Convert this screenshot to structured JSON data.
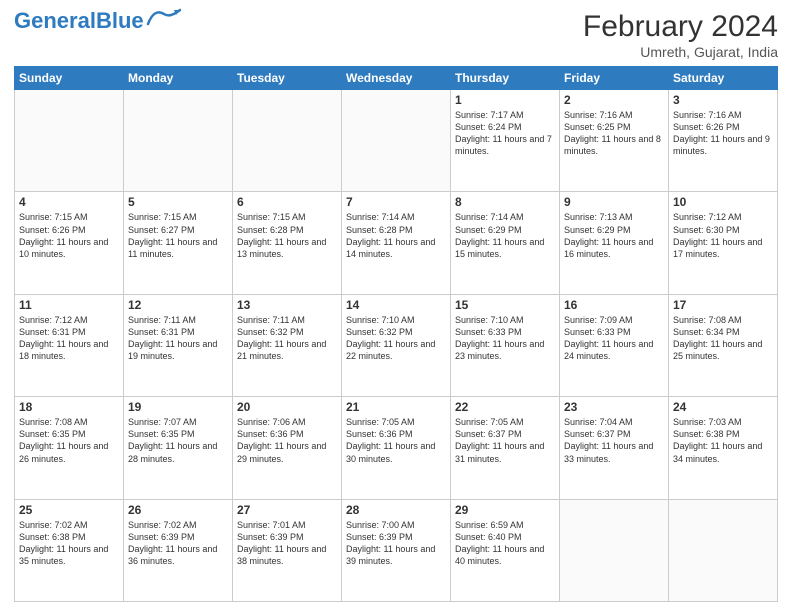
{
  "header": {
    "logo_general": "General",
    "logo_blue": "Blue",
    "month_year": "February 2024",
    "location": "Umreth, Gujarat, India"
  },
  "days_of_week": [
    "Sunday",
    "Monday",
    "Tuesday",
    "Wednesday",
    "Thursday",
    "Friday",
    "Saturday"
  ],
  "weeks": [
    [
      {
        "day": "",
        "info": ""
      },
      {
        "day": "",
        "info": ""
      },
      {
        "day": "",
        "info": ""
      },
      {
        "day": "",
        "info": ""
      },
      {
        "day": "1",
        "info": "Sunrise: 7:17 AM\nSunset: 6:24 PM\nDaylight: 11 hours and 7 minutes."
      },
      {
        "day": "2",
        "info": "Sunrise: 7:16 AM\nSunset: 6:25 PM\nDaylight: 11 hours and 8 minutes."
      },
      {
        "day": "3",
        "info": "Sunrise: 7:16 AM\nSunset: 6:26 PM\nDaylight: 11 hours and 9 minutes."
      }
    ],
    [
      {
        "day": "4",
        "info": "Sunrise: 7:15 AM\nSunset: 6:26 PM\nDaylight: 11 hours and 10 minutes."
      },
      {
        "day": "5",
        "info": "Sunrise: 7:15 AM\nSunset: 6:27 PM\nDaylight: 11 hours and 11 minutes."
      },
      {
        "day": "6",
        "info": "Sunrise: 7:15 AM\nSunset: 6:28 PM\nDaylight: 11 hours and 13 minutes."
      },
      {
        "day": "7",
        "info": "Sunrise: 7:14 AM\nSunset: 6:28 PM\nDaylight: 11 hours and 14 minutes."
      },
      {
        "day": "8",
        "info": "Sunrise: 7:14 AM\nSunset: 6:29 PM\nDaylight: 11 hours and 15 minutes."
      },
      {
        "day": "9",
        "info": "Sunrise: 7:13 AM\nSunset: 6:29 PM\nDaylight: 11 hours and 16 minutes."
      },
      {
        "day": "10",
        "info": "Sunrise: 7:12 AM\nSunset: 6:30 PM\nDaylight: 11 hours and 17 minutes."
      }
    ],
    [
      {
        "day": "11",
        "info": "Sunrise: 7:12 AM\nSunset: 6:31 PM\nDaylight: 11 hours and 18 minutes."
      },
      {
        "day": "12",
        "info": "Sunrise: 7:11 AM\nSunset: 6:31 PM\nDaylight: 11 hours and 19 minutes."
      },
      {
        "day": "13",
        "info": "Sunrise: 7:11 AM\nSunset: 6:32 PM\nDaylight: 11 hours and 21 minutes."
      },
      {
        "day": "14",
        "info": "Sunrise: 7:10 AM\nSunset: 6:32 PM\nDaylight: 11 hours and 22 minutes."
      },
      {
        "day": "15",
        "info": "Sunrise: 7:10 AM\nSunset: 6:33 PM\nDaylight: 11 hours and 23 minutes."
      },
      {
        "day": "16",
        "info": "Sunrise: 7:09 AM\nSunset: 6:33 PM\nDaylight: 11 hours and 24 minutes."
      },
      {
        "day": "17",
        "info": "Sunrise: 7:08 AM\nSunset: 6:34 PM\nDaylight: 11 hours and 25 minutes."
      }
    ],
    [
      {
        "day": "18",
        "info": "Sunrise: 7:08 AM\nSunset: 6:35 PM\nDaylight: 11 hours and 26 minutes."
      },
      {
        "day": "19",
        "info": "Sunrise: 7:07 AM\nSunset: 6:35 PM\nDaylight: 11 hours and 28 minutes."
      },
      {
        "day": "20",
        "info": "Sunrise: 7:06 AM\nSunset: 6:36 PM\nDaylight: 11 hours and 29 minutes."
      },
      {
        "day": "21",
        "info": "Sunrise: 7:05 AM\nSunset: 6:36 PM\nDaylight: 11 hours and 30 minutes."
      },
      {
        "day": "22",
        "info": "Sunrise: 7:05 AM\nSunset: 6:37 PM\nDaylight: 11 hours and 31 minutes."
      },
      {
        "day": "23",
        "info": "Sunrise: 7:04 AM\nSunset: 6:37 PM\nDaylight: 11 hours and 33 minutes."
      },
      {
        "day": "24",
        "info": "Sunrise: 7:03 AM\nSunset: 6:38 PM\nDaylight: 11 hours and 34 minutes."
      }
    ],
    [
      {
        "day": "25",
        "info": "Sunrise: 7:02 AM\nSunset: 6:38 PM\nDaylight: 11 hours and 35 minutes."
      },
      {
        "day": "26",
        "info": "Sunrise: 7:02 AM\nSunset: 6:39 PM\nDaylight: 11 hours and 36 minutes."
      },
      {
        "day": "27",
        "info": "Sunrise: 7:01 AM\nSunset: 6:39 PM\nDaylight: 11 hours and 38 minutes."
      },
      {
        "day": "28",
        "info": "Sunrise: 7:00 AM\nSunset: 6:39 PM\nDaylight: 11 hours and 39 minutes."
      },
      {
        "day": "29",
        "info": "Sunrise: 6:59 AM\nSunset: 6:40 PM\nDaylight: 11 hours and 40 minutes."
      },
      {
        "day": "",
        "info": ""
      },
      {
        "day": "",
        "info": ""
      }
    ]
  ]
}
